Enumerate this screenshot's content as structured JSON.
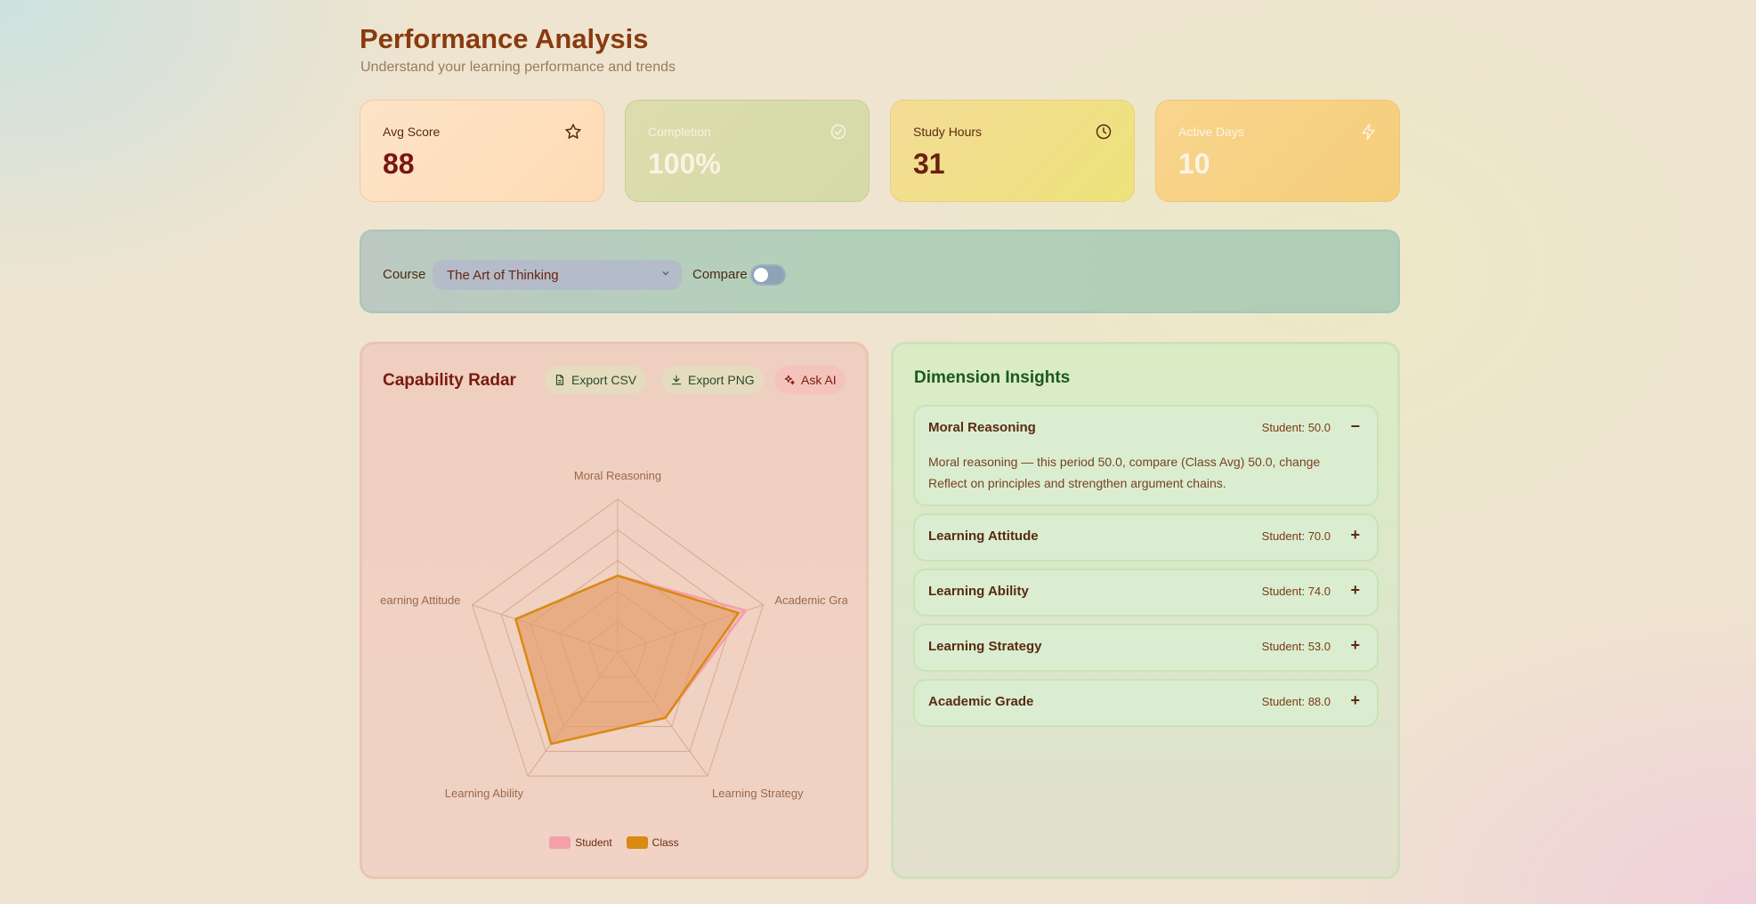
{
  "header": {
    "title": "Performance Analysis",
    "subtitle": "Understand your learning performance and trends"
  },
  "stats": [
    {
      "label": "Avg Score",
      "value": "88",
      "icon": "star-icon"
    },
    {
      "label": "Completion",
      "value": "100%",
      "icon": "check-circle-icon"
    },
    {
      "label": "Study Hours",
      "value": "31",
      "icon": "clock-icon"
    },
    {
      "label": "Active Days",
      "value": "10",
      "icon": "bolt-icon"
    }
  ],
  "filter": {
    "course_label": "Course",
    "course_value": "The Art of Thinking",
    "compare_label": "Compare",
    "compare_on": false
  },
  "radar_card": {
    "title": "Capability Radar",
    "export_csv": "Export CSV",
    "export_png": "Export PNG",
    "ask_ai": "Ask AI"
  },
  "chart_data": {
    "type": "radar",
    "axes": [
      "Moral Reasoning",
      "Academic Grade",
      "Learning Strategy",
      "Learning Ability",
      "Learning Attitude"
    ],
    "max": 100,
    "series": [
      {
        "name": "Student",
        "values": [
          50,
          88,
          53,
          74,
          70
        ],
        "color": "#f4a0a8"
      },
      {
        "name": "Class",
        "values": [
          50,
          83,
          53,
          74,
          70
        ],
        "color": "#d98a10"
      }
    ],
    "grid_levels": 5
  },
  "insights": {
    "title": "Dimension Insights",
    "items": [
      {
        "name": "Moral Reasoning",
        "score": "Student: 50.0",
        "toggle": "−",
        "expanded": true,
        "desc": "Moral reasoning — this period 50.0, compare (Class Avg) 50.0, change Reflect on principles and strengthen argument chains."
      },
      {
        "name": "Learning Attitude",
        "score": "Student: 70.0",
        "toggle": "+"
      },
      {
        "name": "Learning Ability",
        "score": "Student: 74.0",
        "toggle": "+"
      },
      {
        "name": "Learning Strategy",
        "score": "Student: 53.0",
        "toggle": "+"
      },
      {
        "name": "Academic Grade",
        "score": "Student: 88.0",
        "toggle": "+"
      }
    ]
  }
}
